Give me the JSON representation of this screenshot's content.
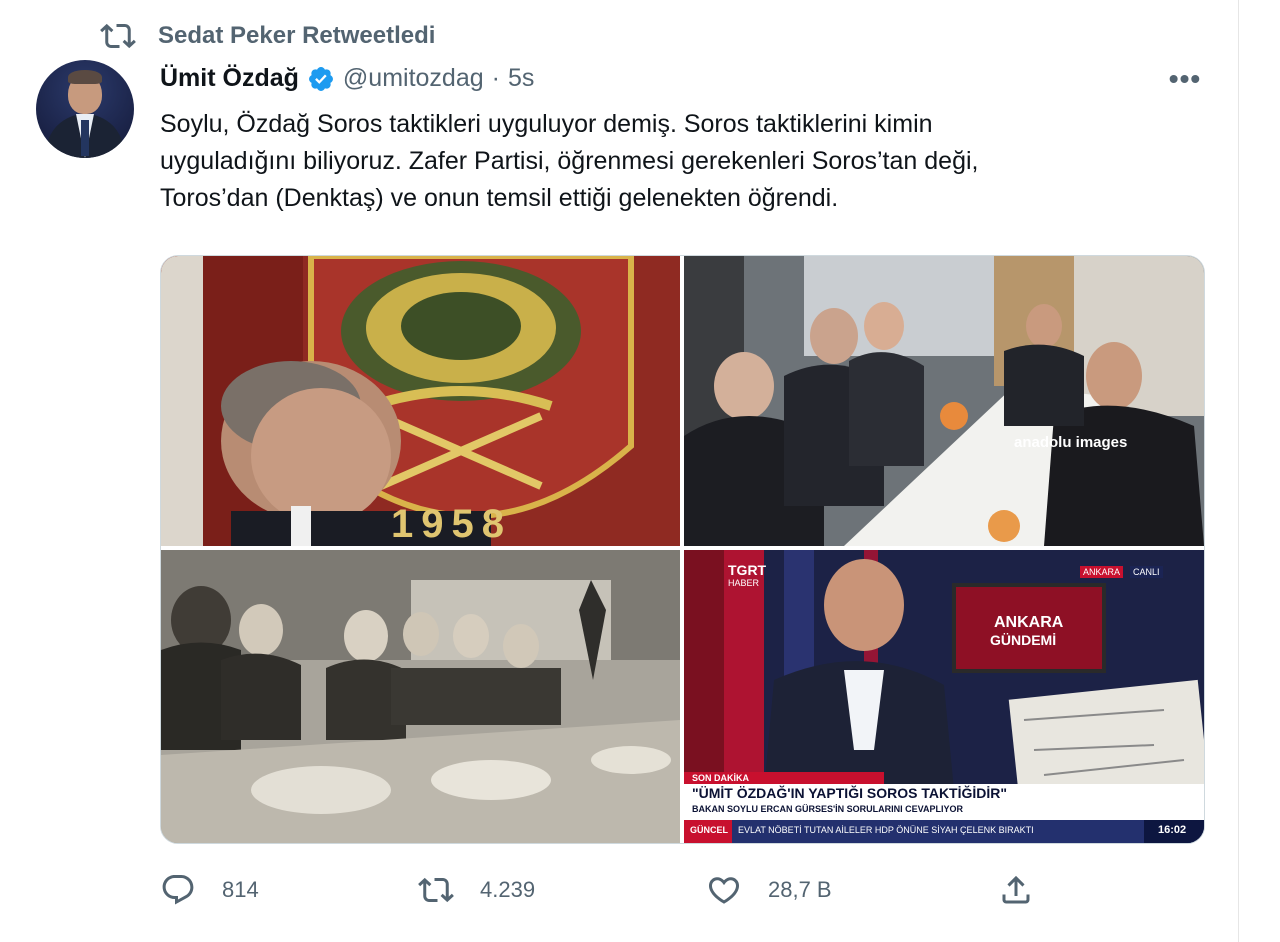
{
  "retweet_context": {
    "icon": "retweet-icon",
    "label": "Sedat Peker Retweetledi"
  },
  "tweet": {
    "author_name": "Ümit Özdağ",
    "verified": true,
    "handle": "@umitozdag",
    "separator": "·",
    "time": "5s",
    "more_icon": "ellipsis-icon",
    "more_label": "•••",
    "text_lines": [
      "Soylu, Özdağ Soros taktikleri uyguluyor demiş. Soros taktiklerini kimin",
      "uyguladığını biliyoruz. Zafer Partisi, öğrenmesi gerekenleri Soros’tan deği,",
      "Toros’dan (Denktaş) ve onun temsil ettiği gelenekten öğrendi."
    ]
  },
  "media": {
    "photo_1": {
      "emblem_year": "1958"
    },
    "photo_2": {
      "watermark": "anadolu images"
    },
    "photo_3": {},
    "photo_4": {
      "channel_logo": "TGRT",
      "channel_sub": "HABER",
      "location_tag": "ANKARA",
      "live_tag": "CANLI",
      "screen_title_1": "ANKARA",
      "screen_title_2": "GÜNDEMİ",
      "breaking_tag": "SON DAKİKA",
      "headline": "\"ÜMİT ÖZDAĞ'IN YAPTIĞI SOROS TAKTİĞİDİR\"",
      "subheadline": "BAKAN SOYLU ERCAN GÜRSES'İN SORULARINI CEVAPLIYOR",
      "ticker_tag": "GÜNCEL",
      "ticker_text": "EVLAT NÖBETİ TUTAN AİLELER HDP ÖNÜNE SİYAH ÇELENK BIRAKTI",
      "clock": "16:02"
    }
  },
  "actions": {
    "reply": {
      "icon": "reply-icon",
      "count": "814"
    },
    "retweet": {
      "icon": "retweet-icon",
      "count": "4.239"
    },
    "like": {
      "icon": "heart-icon",
      "count": "28,7 B"
    },
    "share": {
      "icon": "share-icon"
    }
  },
  "colors": {
    "verified_blue": "#1d9bf0",
    "secondary_text": "#536471",
    "primary_text": "#0f1419",
    "tv_red": "#c8102e"
  }
}
